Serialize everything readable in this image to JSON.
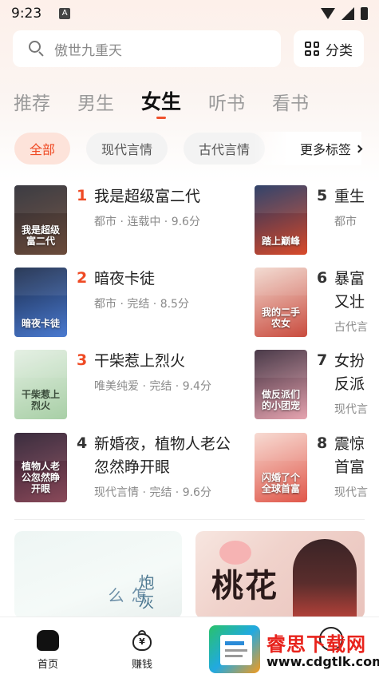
{
  "status_bar": {
    "time": "9:23",
    "notification_letter": "A"
  },
  "search": {
    "placeholder": "傲世九重天"
  },
  "category_button": {
    "label": "分类"
  },
  "channels": [
    {
      "label": "推荐",
      "active": false
    },
    {
      "label": "男生",
      "active": false
    },
    {
      "label": "女生",
      "active": true
    },
    {
      "label": "听书",
      "active": false
    },
    {
      "label": "看书",
      "active": false
    }
  ],
  "tags": [
    {
      "label": "全部",
      "active": true
    },
    {
      "label": "现代言情",
      "active": false
    },
    {
      "label": "古代言情",
      "active": false
    }
  ],
  "more_tags": {
    "label": "更多标签"
  },
  "ranking": [
    {
      "rank": "1",
      "title": "我是超级富二代",
      "meta": "都市 · 连载中 · 9.6分",
      "cover_text": "我是超级富二代",
      "colors": [
        "#2b2b33",
        "#6b4b3a"
      ]
    },
    {
      "rank": "2",
      "title": "暗夜卡徒",
      "meta": "都市 · 完结 · 8.5分",
      "cover_text": "暗夜卡徒",
      "colors": [
        "#1a2a4a",
        "#4a7ad0"
      ]
    },
    {
      "rank": "3",
      "title": "干柴惹上烈火",
      "meta": "唯美纯爱 · 完结 · 9.4分",
      "cover_text": "干柴惹上烈火",
      "colors": [
        "#e3efe2",
        "#a8cfa6"
      ]
    },
    {
      "rank": "4",
      "title": "新婚夜，植物人老公忽然睁开眼",
      "meta": "现代言情 · 完结 · 9.6分",
      "cover_text": "植物人老公忽然睁开眼",
      "colors": [
        "#2a1b2e",
        "#8a4a5a"
      ]
    },
    {
      "rank": "5",
      "title": "重生",
      "meta": "都市",
      "cover_text": "踏上巅峰",
      "colors": [
        "#20345f",
        "#d94a2a"
      ]
    },
    {
      "rank": "6",
      "title": "暴富又壮",
      "meta": "古代言",
      "cover_text": "我的二手农女",
      "colors": [
        "#f2d9cf",
        "#c94b3e"
      ]
    },
    {
      "rank": "7",
      "title": "女扮反派",
      "meta": "现代言",
      "cover_text": "做反派们的小团宠",
      "colors": [
        "#3b2a3a",
        "#e6a4b0"
      ]
    },
    {
      "rank": "8",
      "title": "震惊首富",
      "meta": "现代言",
      "cover_text": "闪婚了个全球首富",
      "colors": [
        "#f7d8cf",
        "#e0574a"
      ]
    }
  ],
  "banners": {
    "left_text_1": "怎么",
    "left_text_2": "炮灰",
    "right_title": "桃花"
  },
  "bottom_nav": [
    {
      "label": "首页",
      "icon": "home-icon"
    },
    {
      "label": "赚钱",
      "icon": "money-bag-icon"
    }
  ],
  "watermark": {
    "title": "睿思下载网",
    "url": "www.cdgtlk.com"
  },
  "colors": {
    "accent": "#ef4a24",
    "tab_indicator": "#f0512d"
  }
}
